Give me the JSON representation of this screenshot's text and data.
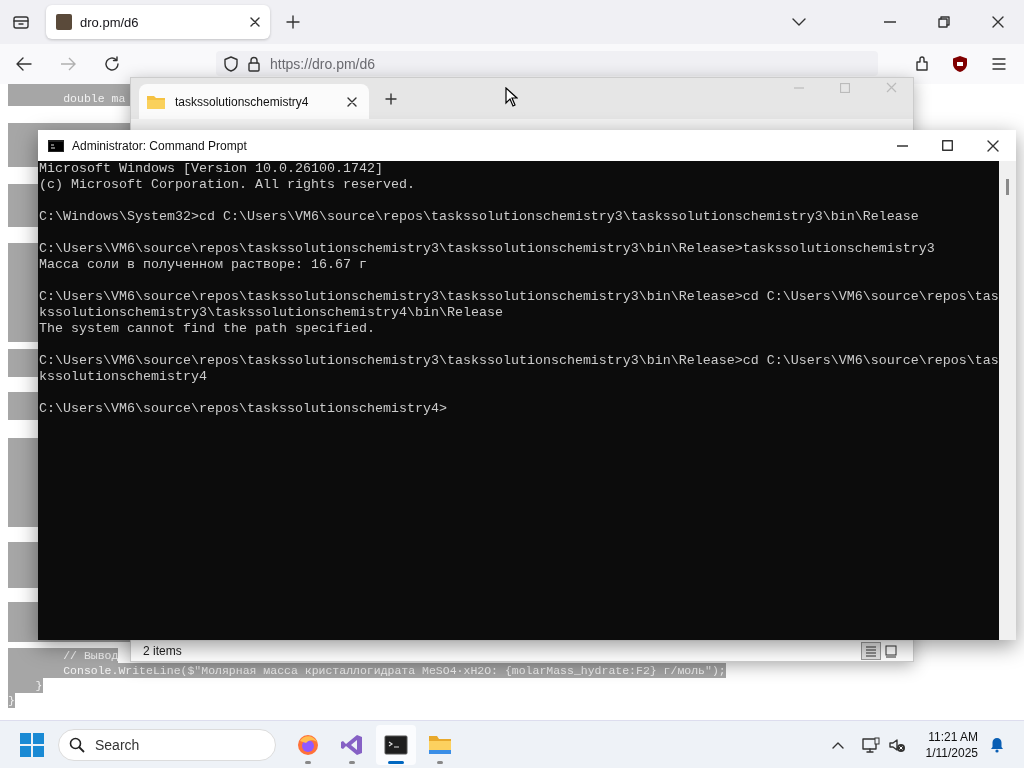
{
  "browser": {
    "tabs": [
      {
        "title": "dro.pm/d6",
        "selected": true
      }
    ],
    "url": "https://dro.pm/d6",
    "code_top": [
      {
        "text": "        double ma",
        "selected": true
      }
    ],
    "code_bottom": [
      {
        "text": "        // Вывод",
        "selected": true
      },
      {
        "text": "        Console.WriteLine($\"Молярная масса кристаллогидрата MeSO4·xH2O: {molarMass_hydrate:F2} г/моль\");",
        "selected": true
      },
      {
        "text": "    }",
        "selected": true
      },
      {
        "text": "}",
        "selected": true
      }
    ]
  },
  "explorer": {
    "tabs": [
      {
        "title": "taskssolutionschemistry4",
        "selected": true
      }
    ],
    "status": "2 items",
    "views": [
      {
        "kind": "details",
        "selected": true
      },
      {
        "kind": "tiles",
        "selected": false
      }
    ]
  },
  "console": {
    "title": "Administrator: Command Prompt",
    "blocks": [
      [
        "Microsoft Windows [Version 10.0.26100.1742]",
        "(c) Microsoft Corporation. All rights reserved."
      ],
      [
        "C:\\Windows\\System32>cd C:\\Users\\VM6\\source\\repos\\taskssolutionschemistry3\\taskssolutionschemistry3\\bin\\Release"
      ],
      [
        "C:\\Users\\VM6\\source\\repos\\taskssolutionschemistry3\\taskssolutionschemistry3\\bin\\Release>taskssolutionschemistry3",
        "Масса соли в полученном растворе: 16.67 г"
      ],
      [
        "C:\\Users\\VM6\\source\\repos\\taskssolutionschemistry3\\taskssolutionschemistry3\\bin\\Release>cd C:\\Users\\VM6\\source\\repos\\tas",
        "kssolutionschemistry3\\taskssolutionschemistry4\\bin\\Release",
        "The system cannot find the path specified."
      ],
      [
        "C:\\Users\\VM6\\source\\repos\\taskssolutionschemistry3\\taskssolutionschemistry3\\bin\\Release>cd C:\\Users\\VM6\\source\\repos\\tas",
        "kssolutionschemistry4"
      ],
      [
        "C:\\Users\\VM6\\source\\repos\\taskssolutionschemistry4>"
      ]
    ]
  },
  "taskbar": {
    "search_placeholder": "Search",
    "apps": [
      {
        "kind": "browser",
        "active": false
      },
      {
        "kind": "ide",
        "active": false
      },
      {
        "kind": "terminal",
        "active": true
      },
      {
        "kind": "folder",
        "active": false
      }
    ],
    "time": "11:21 AM",
    "date": "1/11/2025"
  }
}
